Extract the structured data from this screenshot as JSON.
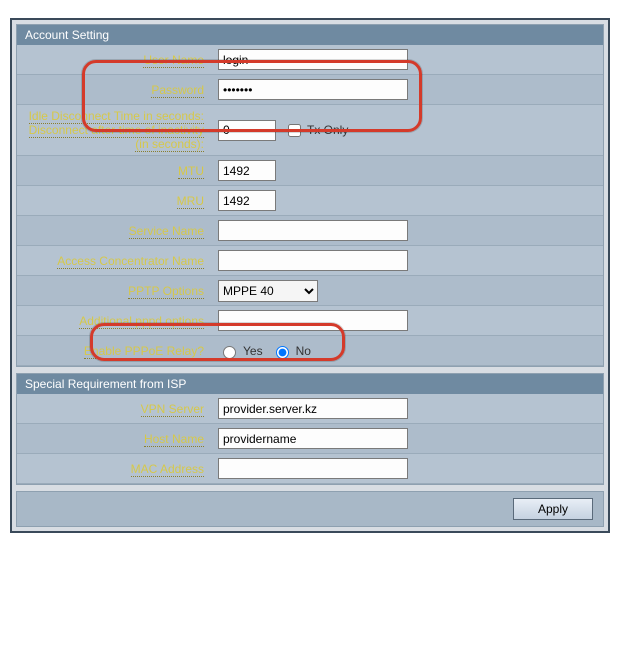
{
  "account": {
    "title": "Account Setting",
    "user_name_label": "User Name",
    "user_name_value": "login",
    "password_label": "Password",
    "password_value": "•••••••",
    "idle_label": "Idle Disconnect Time in seconds: Disconnect after time of inactivity (in seconds):",
    "idle_value": "0",
    "tx_only_label": "Tx Only",
    "mtu_label": "MTU",
    "mtu_value": "1492",
    "mru_label": "MRU",
    "mru_value": "1492",
    "service_name_label": "Service Name",
    "service_name_value": "",
    "access_conc_label": "Access Concentrator Name",
    "access_conc_value": "",
    "pptp_label": "PPTP Options",
    "pptp_value": "MPPE 40",
    "addl_pppd_label": "Additional pppd options",
    "addl_pppd_value": "",
    "relay_label": "Enable PPPoE Relay?",
    "relay_yes": "Yes",
    "relay_no": "No"
  },
  "isp": {
    "title": "Special Requirement from ISP",
    "vpn_label": "VPN Server",
    "vpn_value": "provider.server.kz",
    "host_label": "Host Name",
    "host_value": "providername",
    "mac_label": "MAC Address",
    "mac_value": ""
  },
  "footer": {
    "apply": "Apply"
  }
}
